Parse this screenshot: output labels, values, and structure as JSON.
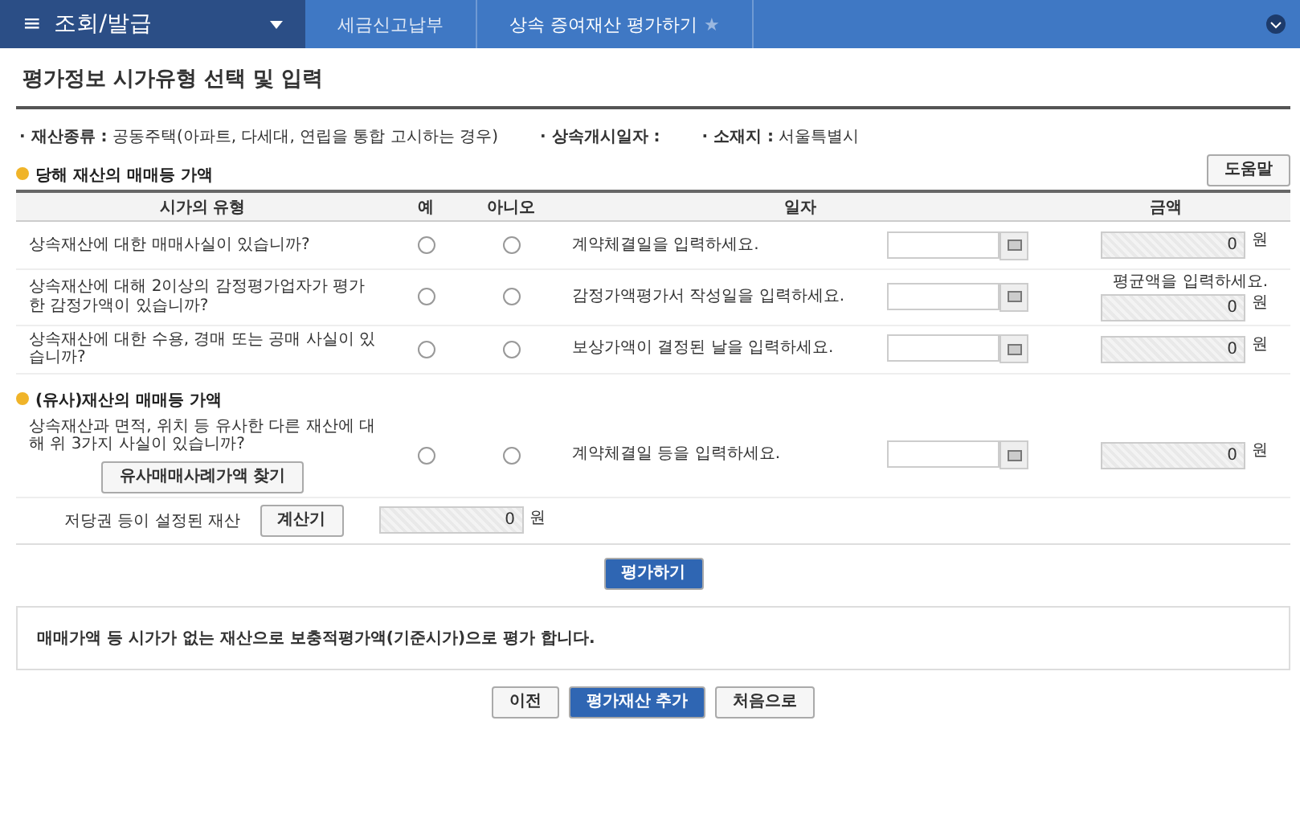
{
  "topbar": {
    "menu_icon": "≡",
    "menu_label": "조회/발급",
    "breadcrumbs": [
      {
        "label": "세금신고납부",
        "selected": false
      },
      {
        "label": "상속 증여재산 평가하기",
        "selected": true,
        "star": "★"
      }
    ]
  },
  "title": "평가정보 시가유형 선택 및 입력",
  "info": [
    {
      "label": "· 재산종류 :",
      "value": "공동주택(아파트, 다세대, 연립을 통합 고시하는 경우)"
    },
    {
      "label": "· 상속개시일자 :"
    },
    {
      "label": "· 소재지 :",
      "value": "서울특별시"
    }
  ],
  "section1": {
    "title": "당해 재산의 매매등 가액",
    "help_button": "도움말"
  },
  "columns": [
    "시가의 유형",
    "예",
    "아니오",
    "일자",
    "금액"
  ],
  "rows": [
    {
      "question": "상속재산에 대한 매매사실이 있습니까?",
      "yes": {
        "selected": false
      },
      "no": {
        "selected": false
      },
      "date_hint": "계약체결일을 입력하세요.",
      "amount": "0",
      "unit": "원"
    },
    {
      "question": "상속재산에 대해 2이상의 감정평가업자가 평가한 감정가액이 있습니까?",
      "yes": {
        "selected": false
      },
      "no": {
        "selected": false
      },
      "date_hint": "감정가액평가서 작성일을 입력하세요.",
      "amount_hint": "평균액을 입력하세요.",
      "amount": "0",
      "unit": "원"
    },
    {
      "question": "상속재산에 대한 수용, 경매 또는 공매 사실이 있습니까?",
      "yes": {
        "selected": false
      },
      "no": {
        "selected": false
      },
      "date_hint": "보상가액이 결정된 날을 입력하세요.",
      "amount": "0",
      "unit": "원"
    }
  ],
  "section2": {
    "title": "(유사)재산의 매매등 가액"
  },
  "similar_row": {
    "question": "상속재산과 면적, 위치 등 유사한 다른 재산에 대해 위 3가지 사실이 있습니까?",
    "button": "유사매매사례가액 찾기",
    "yes": {
      "selected": false
    },
    "no": {
      "selected": false
    },
    "date_hint": "계약체결일 등을 입력하세요.",
    "amount": "0",
    "unit": "원"
  },
  "mortgage": {
    "label": "저당권 등이 설정된 재산",
    "button": "계산기",
    "amount": "0",
    "unit": "원"
  },
  "evaluate_button": "평가하기",
  "notice": "매매가액 등 시가가 없는 재산으로 보충적평가액(기준시가)으로 평가 합니다.",
  "bottom_buttons": [
    {
      "label": "이전",
      "primary": false
    },
    {
      "label": "평가재산 추가",
      "primary": true
    },
    {
      "label": "처음으로",
      "primary": false
    }
  ]
}
